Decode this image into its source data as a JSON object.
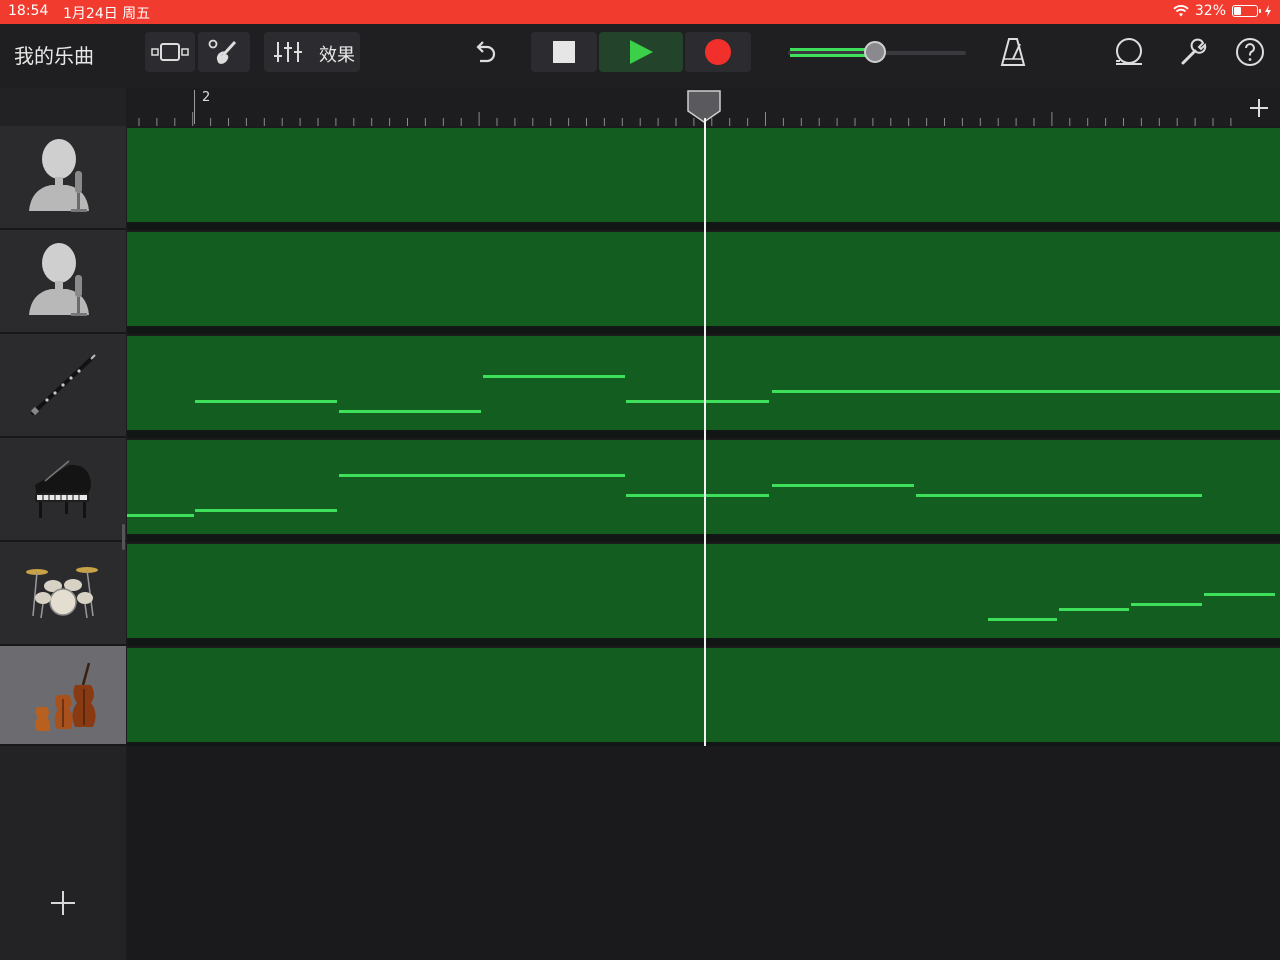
{
  "status_bar": {
    "time": "18:54",
    "date": "1月24日 周五",
    "battery": "32%",
    "battery_level": 0.32,
    "icons": [
      "wifi-icon",
      "battery-icon",
      "charging-icon"
    ]
  },
  "toolbar": {
    "my_songs": "我的乐曲",
    "effects": "效果",
    "master_volume_level": 0.5,
    "icons": [
      "tracks-view-icon",
      "instrument-browser-icon",
      "mixer-icon",
      "undo-icon",
      "stop-icon",
      "play-icon",
      "record-icon",
      "metronome-icon",
      "loop-icon",
      "settings-wrench-icon",
      "help-icon"
    ]
  },
  "timeline": {
    "bar_number": "2",
    "add_section_icon": "plus-icon"
  },
  "tracks": [
    {
      "instrument": "audio-recorder-icon",
      "selected": false
    },
    {
      "instrument": "audio-recorder-icon",
      "selected": false
    },
    {
      "instrument": "clarinet-icon",
      "selected": false
    },
    {
      "instrument": "grand-piano-icon",
      "selected": false
    },
    {
      "instrument": "drum-kit-icon",
      "selected": false
    },
    {
      "instrument": "strings-icon",
      "selected": true
    }
  ],
  "colors": {
    "status_bar": "#f23b2f",
    "region": "#135d21",
    "note": "#3ee05b",
    "play": "#3bd04a",
    "record": "#f2302b"
  }
}
